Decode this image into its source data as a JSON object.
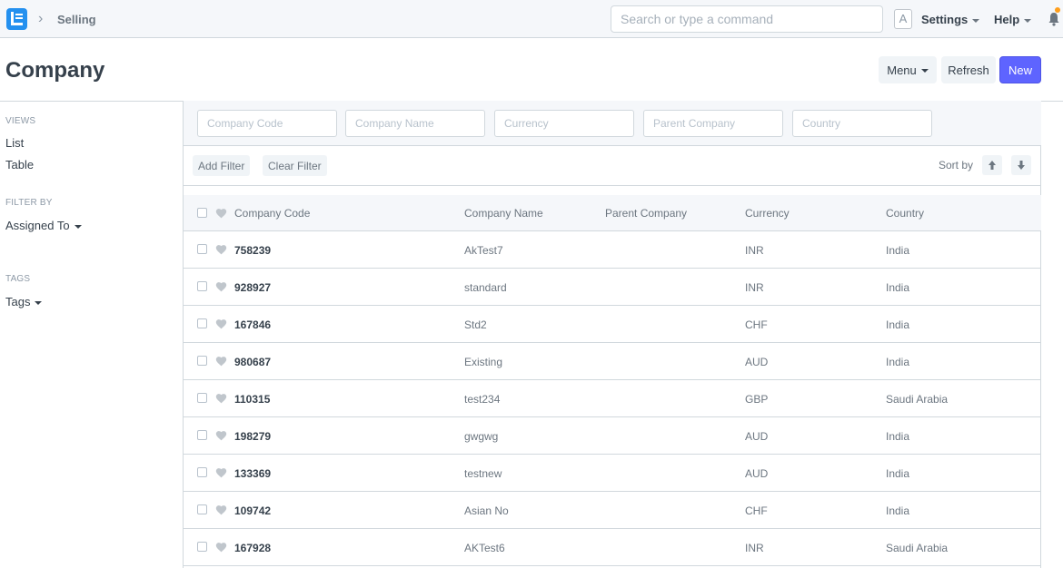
{
  "navbar": {
    "breadcrumb": "Selling",
    "search_placeholder": "Search or type a command",
    "avatar_letter": "A",
    "settings_label": "Settings",
    "help_label": "Help"
  },
  "page": {
    "title": "Company",
    "menu_label": "Menu",
    "refresh_label": "Refresh",
    "new_label": "New"
  },
  "sidebar": {
    "views_label": "VIEWS",
    "views": [
      "List",
      "Table"
    ],
    "filter_by_label": "FILTER BY",
    "assigned_to_label": "Assigned To",
    "tags_label": "TAGS",
    "tags_dropdown": "Tags"
  },
  "filters": {
    "placeholders": [
      "Company Code",
      "Company Name",
      "Currency",
      "Parent Company",
      "Country"
    ],
    "add_filter": "Add Filter",
    "clear_filter": "Clear Filter",
    "sort_by": "Sort by"
  },
  "table": {
    "columns": [
      "Company Code",
      "Company Name",
      "Parent Company",
      "Currency",
      "Country"
    ],
    "rows": [
      {
        "code": "758239",
        "name": "AkTest7",
        "parent": "",
        "currency": "INR",
        "country": "India"
      },
      {
        "code": "928927",
        "name": "standard",
        "parent": "",
        "currency": "INR",
        "country": "India"
      },
      {
        "code": "167846",
        "name": "Std2",
        "parent": "",
        "currency": "CHF",
        "country": "India"
      },
      {
        "code": "980687",
        "name": "Existing",
        "parent": "",
        "currency": "AUD",
        "country": "India"
      },
      {
        "code": "110315",
        "name": "test234",
        "parent": "",
        "currency": "GBP",
        "country": "Saudi Arabia"
      },
      {
        "code": "198279",
        "name": "gwgwg",
        "parent": "",
        "currency": "AUD",
        "country": "India"
      },
      {
        "code": "133369",
        "name": "testnew",
        "parent": "",
        "currency": "AUD",
        "country": "India"
      },
      {
        "code": "109742",
        "name": "Asian No",
        "parent": "",
        "currency": "CHF",
        "country": "India"
      },
      {
        "code": "167928",
        "name": "AKTest6",
        "parent": "",
        "currency": "INR",
        "country": "Saudi Arabia"
      }
    ]
  },
  "colors": {
    "primary": "#5e64ff",
    "logo": "#2490ef",
    "notification": "#ff9e1b"
  }
}
